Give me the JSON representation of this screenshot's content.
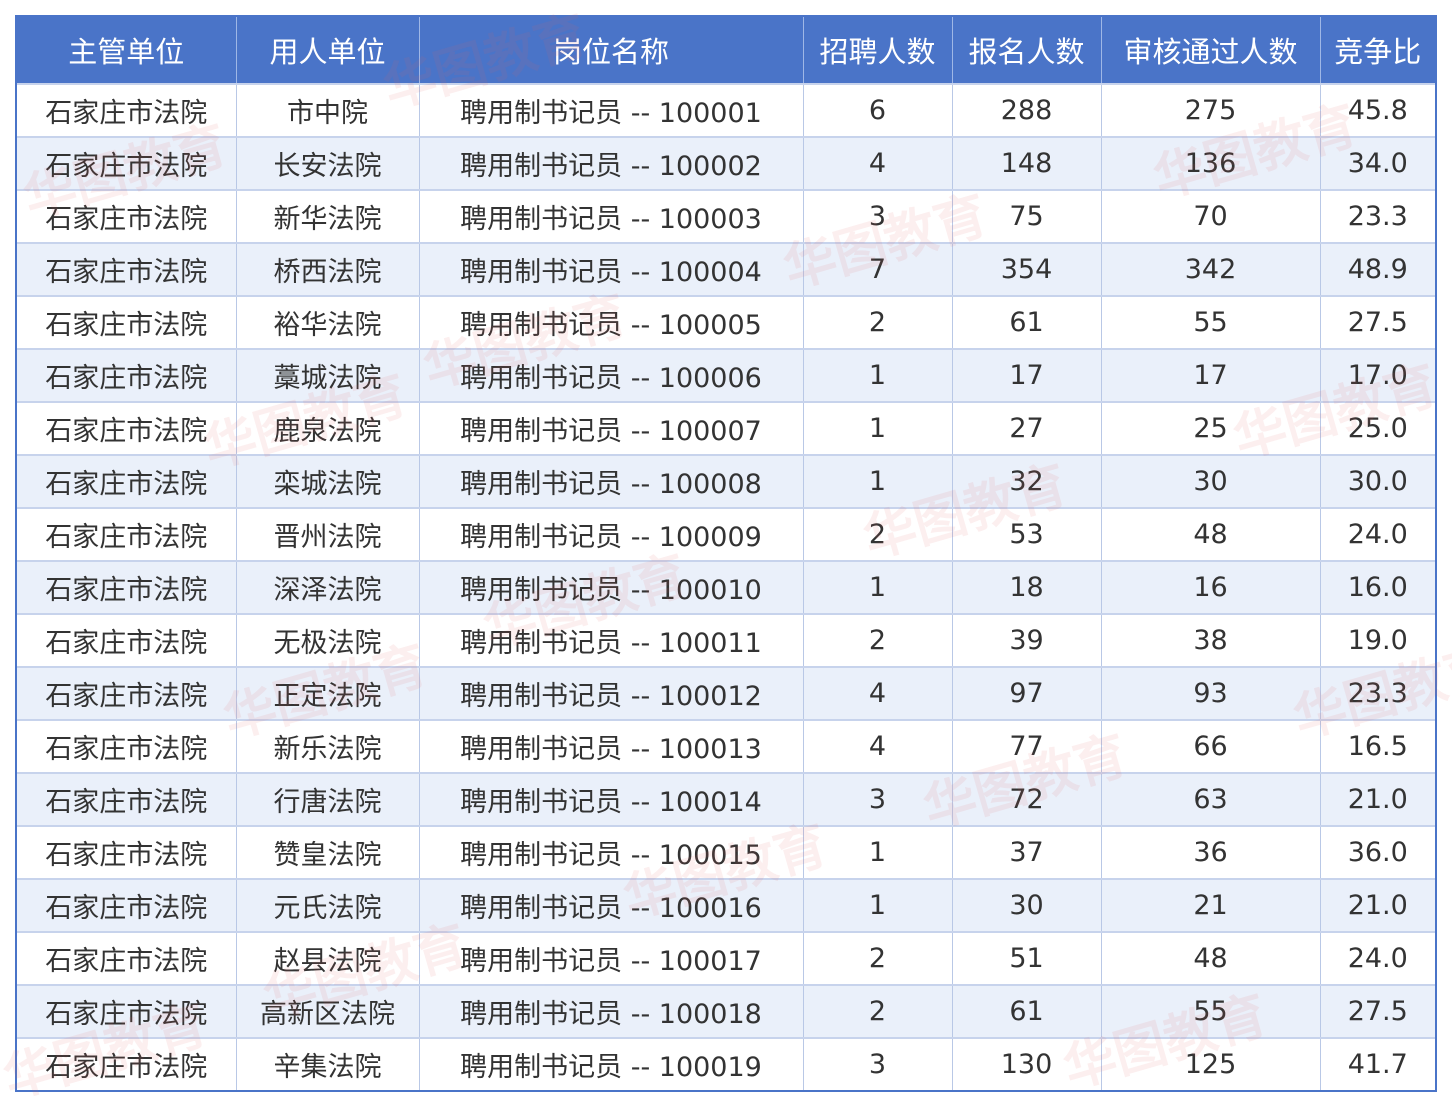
{
  "headers": [
    "主管单位",
    "用人单位",
    "岗位名称",
    "招聘人数",
    "报名人数",
    "审核通过人数",
    "竞争比"
  ],
  "rows": [
    [
      "石家庄市法院",
      "市中院",
      "聘用制书记员 -- 100001",
      "6",
      "288",
      "275",
      "45.8"
    ],
    [
      "石家庄市法院",
      "长安法院",
      "聘用制书记员 -- 100002",
      "4",
      "148",
      "136",
      "34.0"
    ],
    [
      "石家庄市法院",
      "新华法院",
      "聘用制书记员 -- 100003",
      "3",
      "75",
      "70",
      "23.3"
    ],
    [
      "石家庄市法院",
      "桥西法院",
      "聘用制书记员 -- 100004",
      "7",
      "354",
      "342",
      "48.9"
    ],
    [
      "石家庄市法院",
      "裕华法院",
      "聘用制书记员 -- 100005",
      "2",
      "61",
      "55",
      "27.5"
    ],
    [
      "石家庄市法院",
      "藁城法院",
      "聘用制书记员 -- 100006",
      "1",
      "17",
      "17",
      "17.0"
    ],
    [
      "石家庄市法院",
      "鹿泉法院",
      "聘用制书记员 -- 100007",
      "1",
      "27",
      "25",
      "25.0"
    ],
    [
      "石家庄市法院",
      "栾城法院",
      "聘用制书记员 -- 100008",
      "1",
      "32",
      "30",
      "30.0"
    ],
    [
      "石家庄市法院",
      "晋州法院",
      "聘用制书记员 -- 100009",
      "2",
      "53",
      "48",
      "24.0"
    ],
    [
      "石家庄市法院",
      "深泽法院",
      "聘用制书记员 -- 100010",
      "1",
      "18",
      "16",
      "16.0"
    ],
    [
      "石家庄市法院",
      "无极法院",
      "聘用制书记员 -- 100011",
      "2",
      "39",
      "38",
      "19.0"
    ],
    [
      "石家庄市法院",
      "正定法院",
      "聘用制书记员 -- 100012",
      "4",
      "97",
      "93",
      "23.3"
    ],
    [
      "石家庄市法院",
      "新乐法院",
      "聘用制书记员 -- 100013",
      "4",
      "77",
      "66",
      "16.5"
    ],
    [
      "石家庄市法院",
      "行唐法院",
      "聘用制书记员 -- 100014",
      "3",
      "72",
      "63",
      "21.0"
    ],
    [
      "石家庄市法院",
      "赞皇法院",
      "聘用制书记员 -- 100015",
      "1",
      "37",
      "36",
      "36.0"
    ],
    [
      "石家庄市法院",
      "元氏法院",
      "聘用制书记员 -- 100016",
      "1",
      "30",
      "21",
      "21.0"
    ],
    [
      "石家庄市法院",
      "赵县法院",
      "聘用制书记员 -- 100017",
      "2",
      "51",
      "48",
      "24.0"
    ],
    [
      "石家庄市法院",
      "高新区法院",
      "聘用制书记员 -- 100018",
      "2",
      "61",
      "55",
      "27.5"
    ],
    [
      "石家庄市法院",
      "辛集法院",
      "聘用制书记员 -- 100019",
      "3",
      "130",
      "125",
      "41.7"
    ]
  ],
  "watermark_text": "华图教育",
  "colors": {
    "header_bg": "#4a74c8",
    "header_text": "#ffffff",
    "stripe_bg": "#eaf0fa",
    "cell_text": "#333333",
    "watermark": "#e15f5f"
  }
}
